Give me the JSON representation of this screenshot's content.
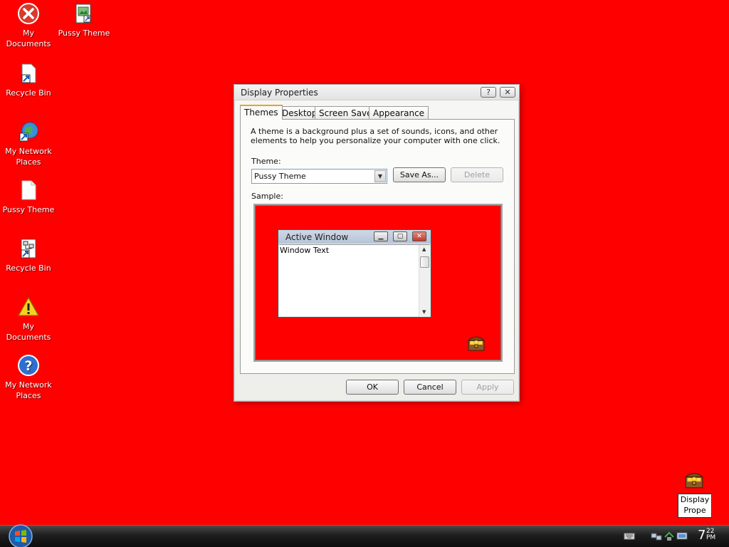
{
  "desktop": {
    "icons": [
      {
        "label": "My Documents",
        "icon": "error-x-icon"
      },
      {
        "label": "Pussy Theme",
        "icon": "image-file-icon"
      },
      {
        "label": "Recycle Bin",
        "icon": "shortcut-file-icon"
      },
      {
        "label": "My Network Places",
        "icon": "globe-shortcut-icon"
      },
      {
        "label": "Pussy Theme",
        "icon": "blank-document-icon"
      },
      {
        "label": "Recycle Bin",
        "icon": "network-shortcut-icon"
      },
      {
        "label": "My Documents",
        "icon": "warning-icon"
      },
      {
        "label": "My Network Places",
        "icon": "help-icon"
      }
    ],
    "background_color": "#ff0000"
  },
  "dialog": {
    "title": "Display Properties",
    "help_btn": "?",
    "close_btn": "✕",
    "tabs": [
      "Themes",
      "Desktop",
      "Screen Saver",
      "Appearance"
    ],
    "active_tab": "Themes",
    "description": "A theme is a background plus a set of sounds, icons, and other elements to help you personalize your computer with one click.",
    "theme_label": "Theme:",
    "theme_value": "Pussy Theme",
    "save_as": "Save As...",
    "delete": "Delete",
    "sample_label": "Sample:",
    "sample": {
      "window_title": "Active Window",
      "window_text": "Window Text"
    },
    "ok": "OK",
    "cancel": "Cancel",
    "apply": "Apply"
  },
  "notification": {
    "line1": "Display",
    "line2": "Prope"
  },
  "taskbar": {
    "clock_hour": "7",
    "clock_min": "22",
    "clock_ampm": "PM"
  }
}
